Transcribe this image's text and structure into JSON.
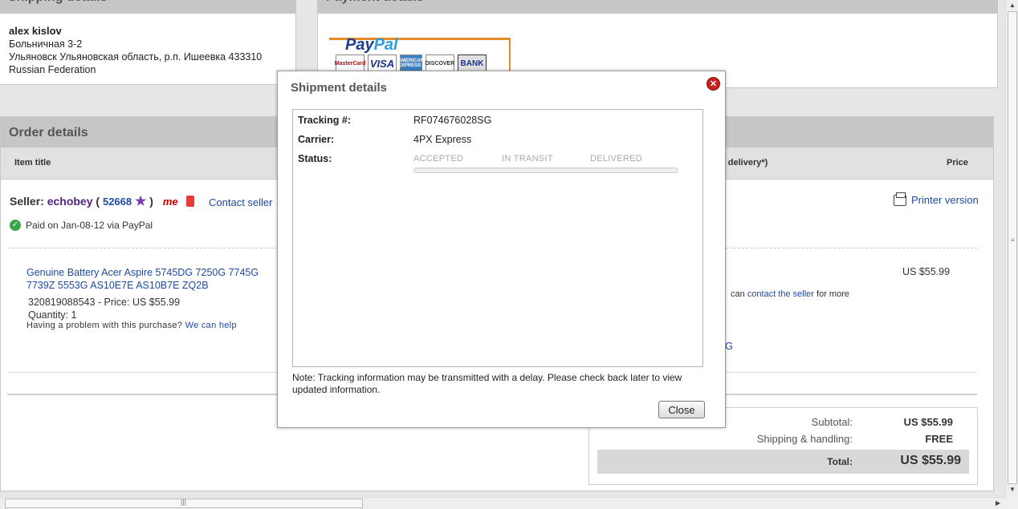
{
  "shipping": {
    "heading": "Shipping details",
    "name": "alex kislov",
    "line1": "Больничная 3-2",
    "line2": "Ульяновск Ульяновская область, р.п. Ишеевка 433310",
    "country": "Russian Federation"
  },
  "payment": {
    "heading": "Payment details",
    "logo_text_a": "Pay",
    "logo_text_b": "Pal",
    "cards": [
      "MasterCard",
      "VISA",
      "AMERICAN EXPRESS",
      "DISCOVER",
      "BANK"
    ]
  },
  "order": {
    "heading": "Order details",
    "col_item": "Item title",
    "col_delivery": "d delivery*)",
    "col_price": "Price",
    "seller_label": "Seller:",
    "seller_name": "echobey",
    "feedback_open": "(",
    "feedback_score": "52668",
    "feedback_close": ")",
    "me_badge": "me",
    "contact_seller": "Contact seller",
    "paid_text": "Paid on Jan-08-12 via PayPal",
    "printer_version": "Printer version",
    "item_title": "Genuine Battery Acer Aspire 5745DG 7250G 7745G 7739Z 5553G AS10E7E AS10B7E ZQ2B",
    "item_id_price": "320819088543 - Price: US $55.99",
    "quantity": "Quantity: 1",
    "help_text": "Having a problem with this purchase?",
    "help_link": "We can help",
    "item_price": "US $55.99",
    "note_prefix": "can",
    "note_link": "contact the seller",
    "note_suffix": "for more",
    "tail_text": "G"
  },
  "totals": {
    "subtotal_label": "Subtotal:",
    "subtotal_value": "US $55.99",
    "shipping_label": "Shipping & handling:",
    "shipping_value": "FREE",
    "total_label": "Total:",
    "total_value": "US $55.99"
  },
  "modal": {
    "title": "Shipment details",
    "tracking_label": "Tracking #:",
    "tracking_value": "RF074676028SG",
    "carrier_label": "Carrier:",
    "carrier_value": "4PX Express",
    "status_label": "Status:",
    "stages": [
      "ACCEPTED",
      "IN TRANSIT",
      "DELIVERED"
    ],
    "progress": 0,
    "note": "Note: Tracking information may be transmitted with a delay. Please check back later to view updated information.",
    "close_label": "Close",
    "close_icon": "close-x-icon"
  },
  "colors": {
    "link": "#1e4ba2",
    "panel_head": "#c6c6c6",
    "close_icon": "#c8201f",
    "paypal_border": "#e38b2a"
  }
}
